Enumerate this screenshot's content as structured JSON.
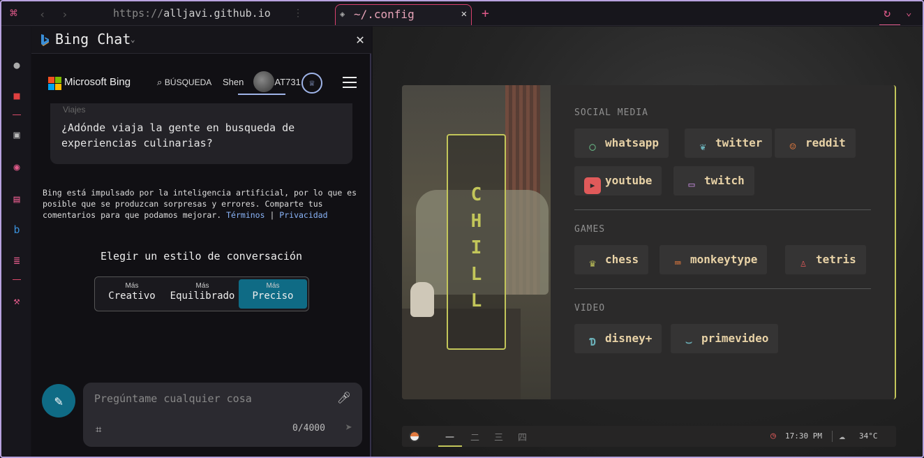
{
  "browser": {
    "url_scheme": "https://",
    "url_host": "alljavi.github.io",
    "tab_title": "~/.config",
    "new_tab": "+",
    "accent": "#e05a8a"
  },
  "bing": {
    "panel_title": "Bing Chat",
    "brand": "Microsoft Bing",
    "nav_search": "BÚSQUEDA",
    "nav_user": "Shen",
    "nav_chat": "CHAT",
    "user_count": "731",
    "suggestion_category": "Viajes",
    "suggestion_text": "¿Adónde viaja la gente en busqueda de experiencias culinarias?",
    "disclaimer": "Bing está impulsado por la inteligencia artificial, por lo que es posible que se produzcan sorpresas y errores. Comparte tus comentarios para que podamos mejorar.",
    "terms": "Términos",
    "privacy": "Privacidad",
    "style_title": "Elegir un estilo de conversación",
    "styles": [
      {
        "small": "Más",
        "big": "Creativo"
      },
      {
        "small": "Más",
        "big": "Equilibrado"
      },
      {
        "small": "Más",
        "big": "Preciso"
      }
    ],
    "input_placeholder": "Pregúntame cualquier cosa",
    "char_count": "0/4000"
  },
  "startpage": {
    "chill": [
      "C",
      "H",
      "I",
      "L",
      "L"
    ],
    "sections": [
      {
        "title": "SOCIAL MEDIA",
        "links": [
          "whatsapp",
          "twitter",
          "reddit",
          "youtube",
          "twitch"
        ]
      },
      {
        "title": "GAMES",
        "links": [
          "chess",
          "monkeytype",
          "tetris"
        ]
      },
      {
        "title": "VIDEO",
        "links": [
          "disney+",
          "primevideo"
        ]
      }
    ],
    "accent": "#c3c65a"
  },
  "bar": {
    "workspaces": [
      "一",
      "二",
      "三",
      "四"
    ],
    "time": "17:30 PM",
    "temp": "34°C"
  }
}
